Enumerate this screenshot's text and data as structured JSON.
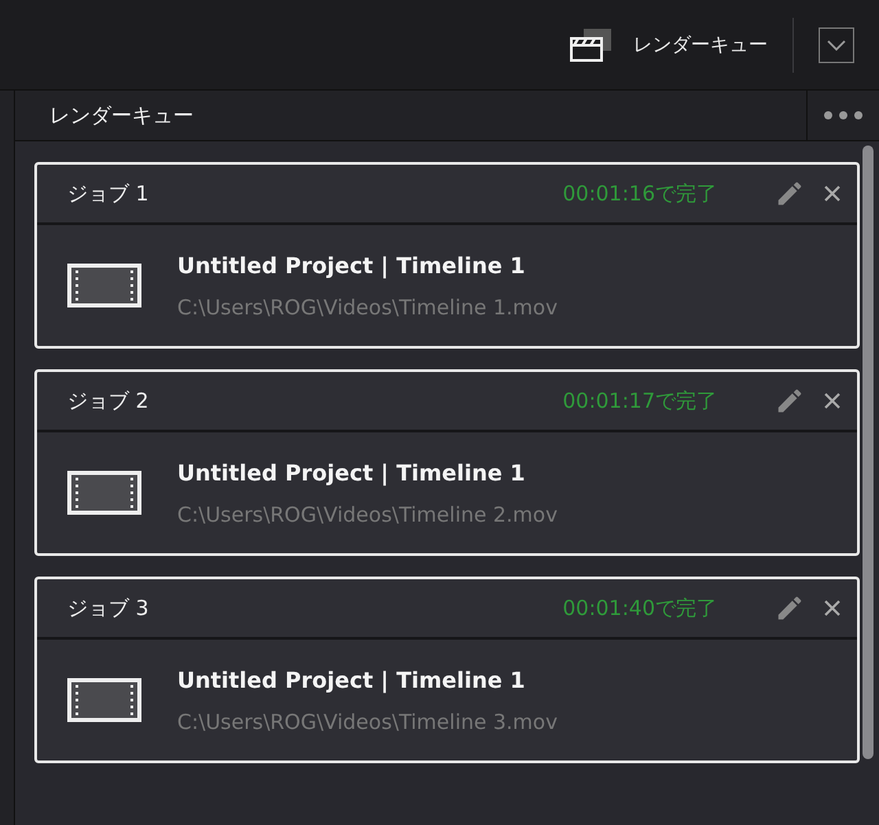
{
  "toolbar": {
    "render_queue_button": "レンダーキュー"
  },
  "panel": {
    "title": "レンダーキュー"
  },
  "jobs": [
    {
      "name": "ジョブ 1",
      "status": "00:01:16で完了",
      "title": "Untitled Project | Timeline 1",
      "path": "C:\\Users\\ROG\\Videos\\Timeline 1.mov"
    },
    {
      "name": "ジョブ 2",
      "status": "00:01:17で完了",
      "title": "Untitled Project | Timeline 1",
      "path": "C:\\Users\\ROG\\Videos\\Timeline 2.mov"
    },
    {
      "name": "ジョブ 3",
      "status": "00:01:40で完了",
      "title": "Untitled Project | Timeline 1",
      "path": "C:\\Users\\ROG\\Videos\\Timeline 3.mov"
    }
  ]
}
